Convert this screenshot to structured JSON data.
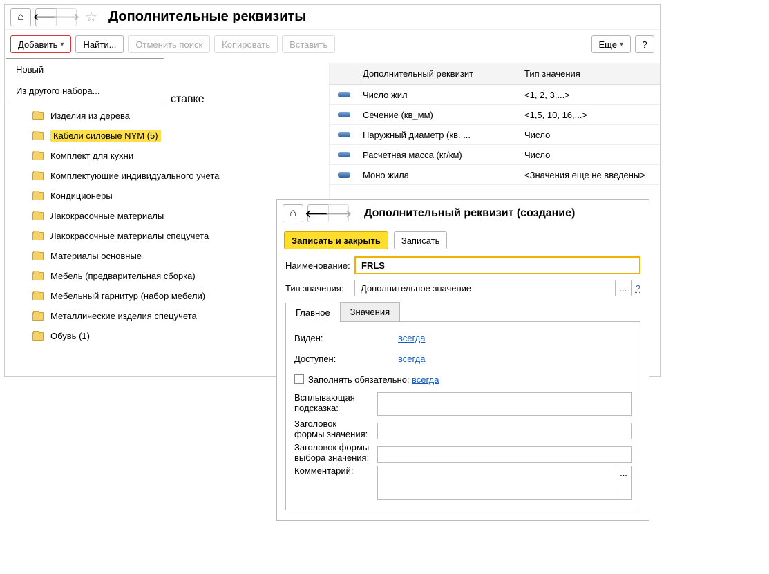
{
  "main": {
    "title": "Дополнительные реквизиты",
    "nav": {
      "home": "⌂",
      "back": "🡐",
      "forward": "🡒"
    },
    "star": "☆",
    "toolbar": {
      "add": "Добавить",
      "find": "Найти...",
      "cancel_search": "Отменить поиск",
      "copy": "Копировать",
      "paste": "Вставить",
      "more": "Еще",
      "help": "?"
    },
    "menu": {
      "new": "Новый",
      "from_set": "Из другого набора..."
    },
    "tree_fragment_tail": "ставке",
    "tree": [
      "Изделия из дерева",
      "Кабели силовые NYM (5)",
      "Комплект для кухни",
      "Комплектующие индивидуального учета",
      "Кондиционеры",
      "Лакокрасочные материалы",
      "Лакокрасочные материалы спецучета",
      "Материалы основные",
      "Мебель (предварительная сборка)",
      "Мебельный гарнитур (набор мебели)",
      "Металлические изделия спецучета",
      "Обувь (1)"
    ],
    "tree_selected": 1,
    "grid": {
      "col_attr": "Дополнительный реквизит",
      "col_type": "Тип значения",
      "rows": [
        {
          "name": "Число жил",
          "type": "<1, 2, 3,...>"
        },
        {
          "name": "Сечение (кв_мм)",
          "type": "<1,5, 10, 16,...>"
        },
        {
          "name": "Наружный диаметр (кв. ...",
          "type": "Число"
        },
        {
          "name": "Расчетная масса (кг/км)",
          "type": "Число"
        },
        {
          "name": "Моно жила",
          "type": "<Значения еще не введены>"
        }
      ]
    }
  },
  "dlg": {
    "title": "Дополнительный реквизит (создание)",
    "save_close": "Записать и закрыть",
    "save": "Записать",
    "name_label": "Наименование:",
    "name_value": "FRLS",
    "type_label": "Тип значения:",
    "type_value": "Дополнительное значение",
    "type_more": "...",
    "help": "?",
    "tabs": {
      "main": "Главное",
      "values": "Значения"
    },
    "props": {
      "visible_label": "Виден:",
      "visible_value": "всегда",
      "available_label": "Доступен:",
      "available_value": "всегда",
      "required_label": "Заполнять обязательно:",
      "required_value": "всегда",
      "tooltip_label1": "Всплывающая",
      "tooltip_label2": "подсказка:",
      "valform_label1": "Заголовок",
      "valform_label2": "формы значения:",
      "choiceform_label1": "Заголовок формы",
      "choiceform_label2": "выбора значения:",
      "comment_label": "Комментарий:",
      "ellipsis": "..."
    }
  }
}
